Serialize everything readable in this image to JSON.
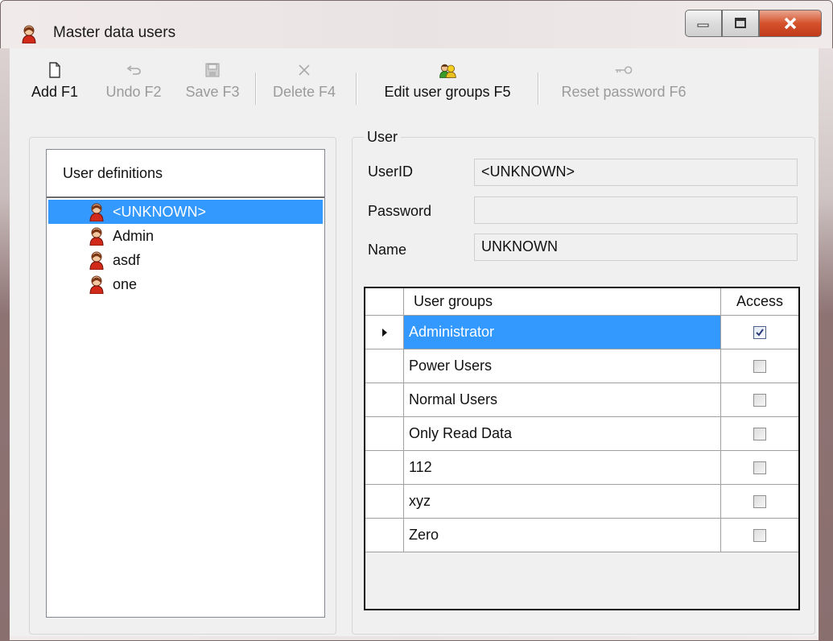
{
  "window": {
    "title": "Master data users"
  },
  "toolbar": {
    "add": "Add F1",
    "undo": "Undo F2",
    "save": "Save F3",
    "delete": "Delete F4",
    "edit_groups": "Edit user groups F5",
    "reset_password": "Reset password F6"
  },
  "users_list": {
    "header": "User definitions",
    "items": [
      "<UNKNOWN>",
      "Admin",
      "asdf",
      "one"
    ],
    "selected_index": 0
  },
  "user": {
    "group_title": "User",
    "userid_label": "UserID",
    "userid_value": "<UNKNOWN>",
    "password_label": "Password",
    "password_value": "",
    "name_label": "Name",
    "name_value": "UNKNOWN"
  },
  "groups_grid": {
    "col_groups": "User groups",
    "col_access": "Access",
    "rows": [
      {
        "name": "Administrator",
        "access": true
      },
      {
        "name": "Power Users",
        "access": false
      },
      {
        "name": "Normal Users",
        "access": false
      },
      {
        "name": "Only Read Data",
        "access": false
      },
      {
        "name": "112",
        "access": false
      },
      {
        "name": "xyz",
        "access": false
      },
      {
        "name": "Zero",
        "access": false
      }
    ]
  },
  "colors": {
    "selection": "#3399ff",
    "close_button": "#c7402a"
  }
}
